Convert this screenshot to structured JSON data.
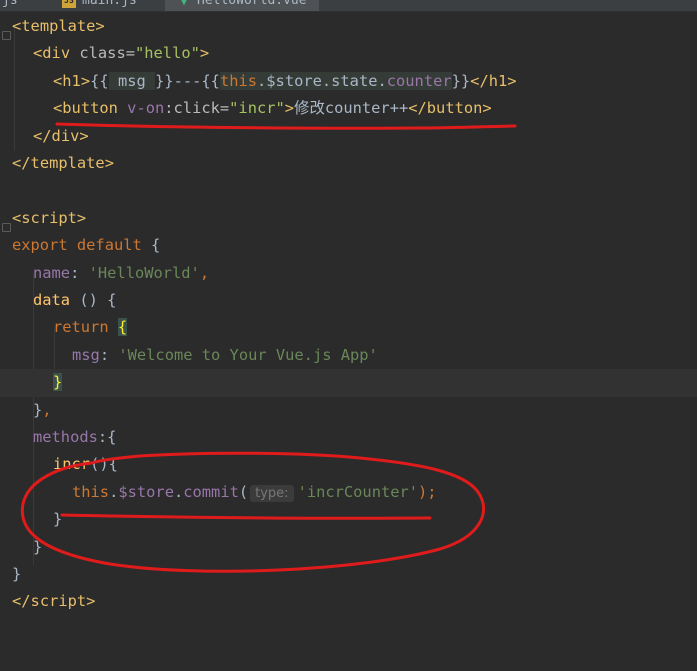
{
  "tabs": [
    {
      "label": "js",
      "icon": "js-file-icon"
    },
    {
      "label": "main.js",
      "icon": "js-file-icon"
    },
    {
      "label": "HelloWorld.vue",
      "icon": "vue-file-icon",
      "active": true
    }
  ],
  "code": {
    "l1": {
      "open": "<",
      "tag": "template",
      "close": ">"
    },
    "l2": {
      "open": "<",
      "tag": "div",
      "sp": " ",
      "attr": "class",
      "eq": "=",
      "val": "\"hello\"",
      "close": ">"
    },
    "l3": {
      "open": "<",
      "tag": "h1",
      "close": ">",
      "mo": "{{",
      "sp1": " ",
      "var": "msg",
      "sp2": " ",
      "mc": "}}",
      "dash": "---",
      "mo2": "{{",
      "this": "this",
      "rest": ".$store.state.",
      "counter": "counter",
      "mc2": "}}",
      "eopen": "</",
      "etag": "h1",
      "eclose": ">"
    },
    "l4": {
      "open": "<",
      "tag": "button",
      "sp": " ",
      "von": "v-on",
      "colon": ":",
      "attr": "click",
      "eq": "=",
      "val": "\"incr\"",
      "close": ">",
      "text": "修改counter++",
      "eopen": "</",
      "etag": "button",
      "eclose": ">"
    },
    "l5": {
      "open": "</",
      "tag": "div",
      "close": ">"
    },
    "l6": {
      "open": "</",
      "tag": "template",
      "close": ">"
    },
    "l8": {
      "open": "<",
      "tag": "script",
      "close": ">"
    },
    "l9": {
      "kw1": "export",
      "sp1": " ",
      "kw2": "default",
      "rest": " {"
    },
    "l10": {
      "prop": "name",
      "colon": ": ",
      "str": "'HelloWorld'",
      "comma": ","
    },
    "l11": {
      "fn": "data",
      "rest": " () {"
    },
    "l12": {
      "kw": "return",
      "sp": " ",
      "brace": "{"
    },
    "l13": {
      "prop": "msg",
      "colon": ": ",
      "str": "'Welcome to Your Vue.js App'"
    },
    "l14": {
      "brace": "}"
    },
    "l15": {
      "brace": "}",
      "comma": ","
    },
    "l16": {
      "prop": "methods",
      "rest": ":{"
    },
    "l17": {
      "fn": "incr",
      "rest": "(){"
    },
    "l18": {
      "this": "this",
      "dot1": ".",
      "store": "$store",
      "dot2": ".",
      "fn": "commit",
      "paren": "(",
      "hint": "type:",
      "str": "'incrCounter'",
      "end": ");"
    },
    "l19": {
      "brace": "}"
    },
    "l20": {
      "brace": "}"
    },
    "l21": {
      "brace": "}"
    },
    "l22": {
      "open": "</",
      "tag": "script",
      "close": ">"
    }
  },
  "annotation_color": "#e01b1b"
}
